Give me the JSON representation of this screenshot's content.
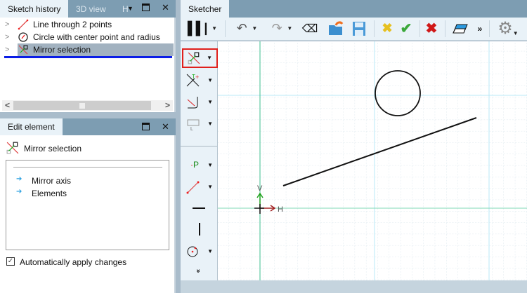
{
  "left_top_panel": {
    "tabs": [
      {
        "label": "Sketch history",
        "active": true
      },
      {
        "label": "3D view",
        "active": false
      },
      {
        "label": "H",
        "active": false
      }
    ],
    "history_items": [
      {
        "label": "Line through 2 points",
        "icon": "line-icon"
      },
      {
        "label": "Circle with center point and radius",
        "icon": "circle-icon"
      },
      {
        "label": "Mirror selection",
        "icon": "mirror-icon",
        "selected": true
      }
    ],
    "scroll_left": "<",
    "scroll_right": ">"
  },
  "edit_panel": {
    "tab": "Edit element",
    "title": "Mirror selection",
    "params": [
      {
        "label": "Mirror axis"
      },
      {
        "label": "Elements"
      }
    ],
    "auto_apply_label": "Automatically apply changes",
    "auto_apply_checked": true
  },
  "sketcher": {
    "tab": "Sketcher",
    "more": "»",
    "axis_v": "V",
    "axis_h": "H",
    "expand": "»"
  },
  "colors": {
    "accent_red": "#e0201c",
    "axis_green": "#3fbf8f",
    "grid_cyan": "#b8e9f7",
    "selection_blue": "#0b1ee6"
  }
}
